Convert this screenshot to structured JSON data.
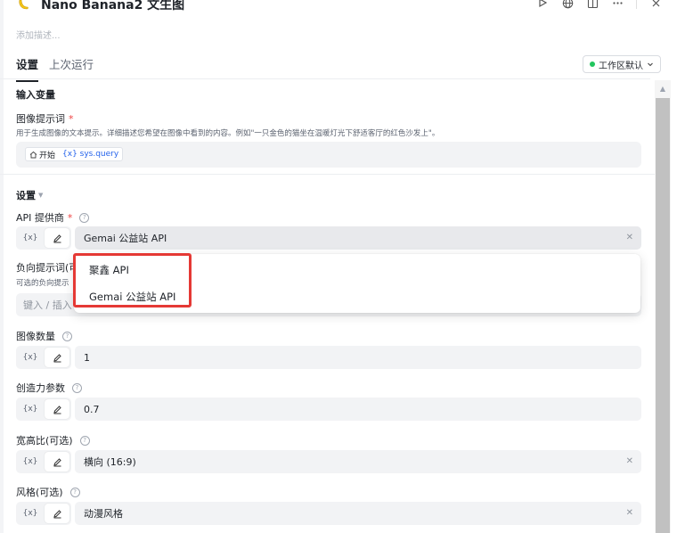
{
  "header": {
    "title": "Nano Banana2 文生图",
    "description_placeholder": "添加描述...",
    "icons": [
      "run-icon",
      "globe-icon",
      "split-view-icon",
      "more-icon",
      "close-icon"
    ]
  },
  "tabs": [
    {
      "label": "设置",
      "active": true
    },
    {
      "label": "上次运行",
      "active": false
    }
  ],
  "workspace": {
    "label": "工作区默认",
    "status_color": "#22c55e"
  },
  "input_vars": {
    "section_title": "输入变量",
    "image_prompt": {
      "label": "图像提示词",
      "required": "*",
      "hint": "用于生成图像的文本提示。详细描述您希望在图像中看到的内容。例如\"一只金色的猫坐在温暖灯光下舒适客厅的红色沙发上\"。",
      "chip_start": "开始",
      "chip_var": "{x} sys.query"
    }
  },
  "settings": {
    "section_title": "设置",
    "fields": {
      "api_provider": {
        "label": "API 提供商",
        "required": "*",
        "mode_var": "{x}",
        "value": "Gemai 公益站 API"
      },
      "negative_prompt": {
        "label": "负向提示词(可",
        "hint": "可选的负向提示",
        "placeholder": "键入 / 插入"
      },
      "image_count": {
        "label": "图像数量",
        "mode_var": "{x}",
        "value": "1"
      },
      "creativity": {
        "label": "创造力参数",
        "mode_var": "{x}",
        "value": "0.7"
      },
      "aspect_ratio": {
        "label": "宽高比(可选)",
        "mode_var": "{x}",
        "value": "横向 (16:9)"
      },
      "style": {
        "label": "风格(可选)",
        "mode_var": "{x}",
        "value": "动漫风格"
      }
    }
  },
  "dropdown": {
    "options": [
      "聚鑫 API",
      "Gemai 公益站 API"
    ]
  },
  "colors": {
    "accent_red": "#e53935",
    "link_blue": "#2563eb"
  }
}
